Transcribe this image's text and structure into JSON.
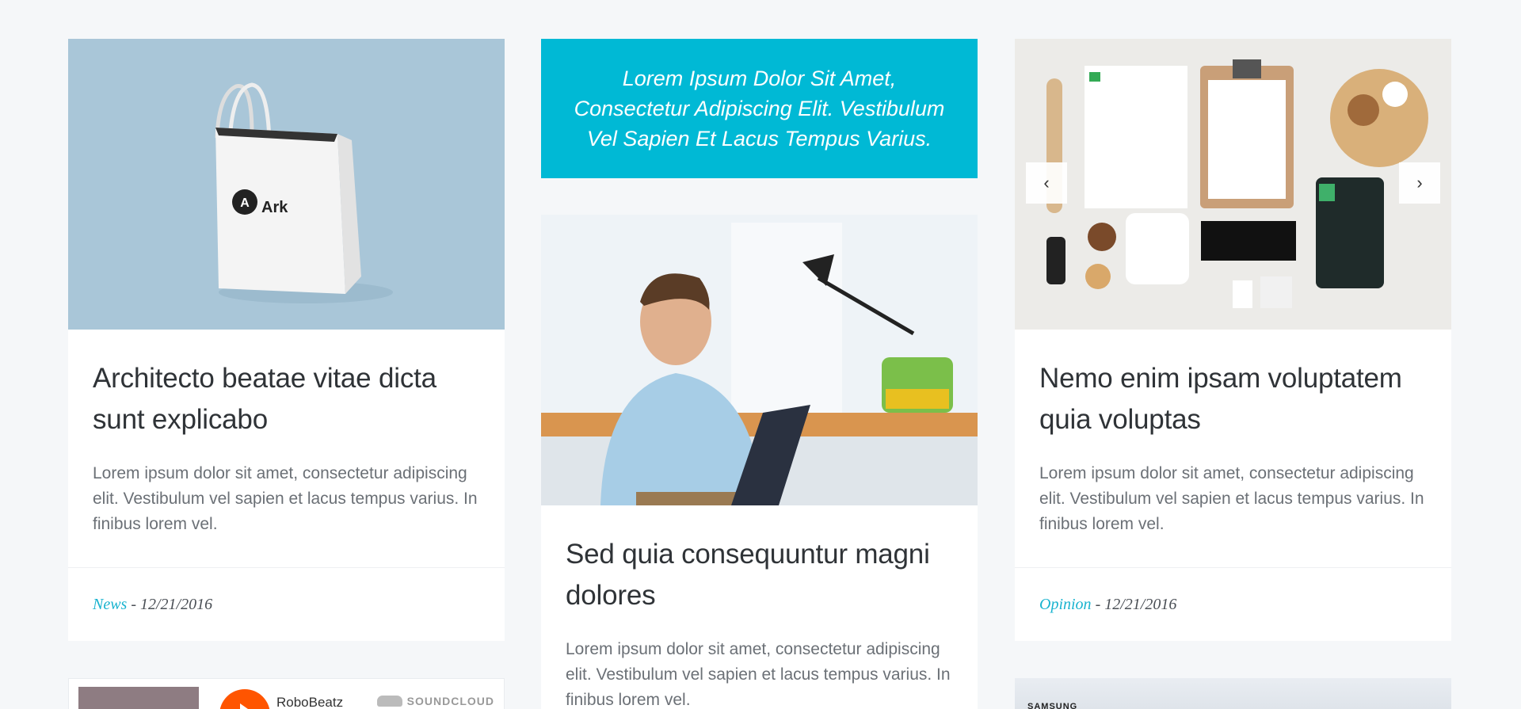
{
  "quote": {
    "text": "Lorem Ipsum Dolor Sit Amet, Consectetur Adipiscing Elit. Vestibulum Vel Sapien Et Lacus Tempus Varius."
  },
  "cards": [
    {
      "title": "Architecto beatae vitae dicta sunt explicabo",
      "excerpt": "Lorem ipsum dolor sit amet, consectetur adipiscing elit. Vestibulum vel sapien et lacus tempus varius. In finibus lorem vel.",
      "category": "News",
      "date": "- 12/21/2016",
      "image_brand": "Ark"
    },
    {
      "title": "Sed quia consequuntur magni dolores",
      "excerpt": "Lorem ipsum dolor sit amet, consectetur adipiscing elit. Vestibulum vel sapien et lacus tempus varius. In finibus lorem vel."
    },
    {
      "title": "Nemo enim ipsam voluptatem quia voluptas",
      "excerpt": "Lorem ipsum dolor sit amet, consectetur adipiscing elit. Vestibulum vel sapien et lacus tempus varius. In finibus lorem vel.",
      "category": "Opinion",
      "date": "- 12/21/2016",
      "carousel": {
        "prev_icon": "‹",
        "next_icon": "›"
      }
    }
  ],
  "soundcloud": {
    "user": "RoboBeatz",
    "brand": "SOUNDCLOUD"
  },
  "samsung": {
    "brand": "SAMSUNG"
  },
  "colors": {
    "accent": "#00b9d5",
    "category": "#19b3cf",
    "background": "#f5f7f9"
  }
}
